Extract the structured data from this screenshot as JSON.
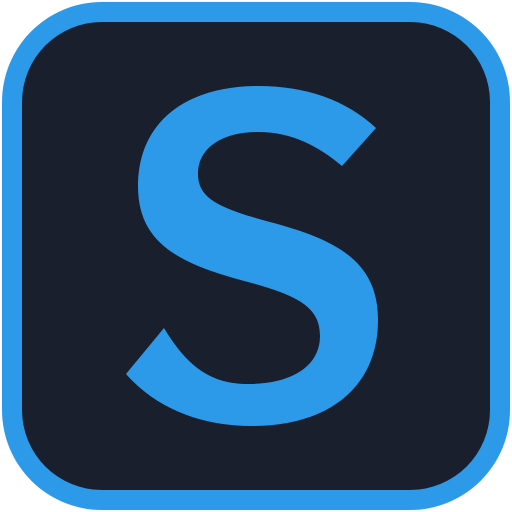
{
  "logo": {
    "letter": "S",
    "icon": "app-logo-icon",
    "colors": {
      "border": "#2c9ae8",
      "background": "#1a1f2d",
      "letter": "#2c9ae8"
    }
  }
}
